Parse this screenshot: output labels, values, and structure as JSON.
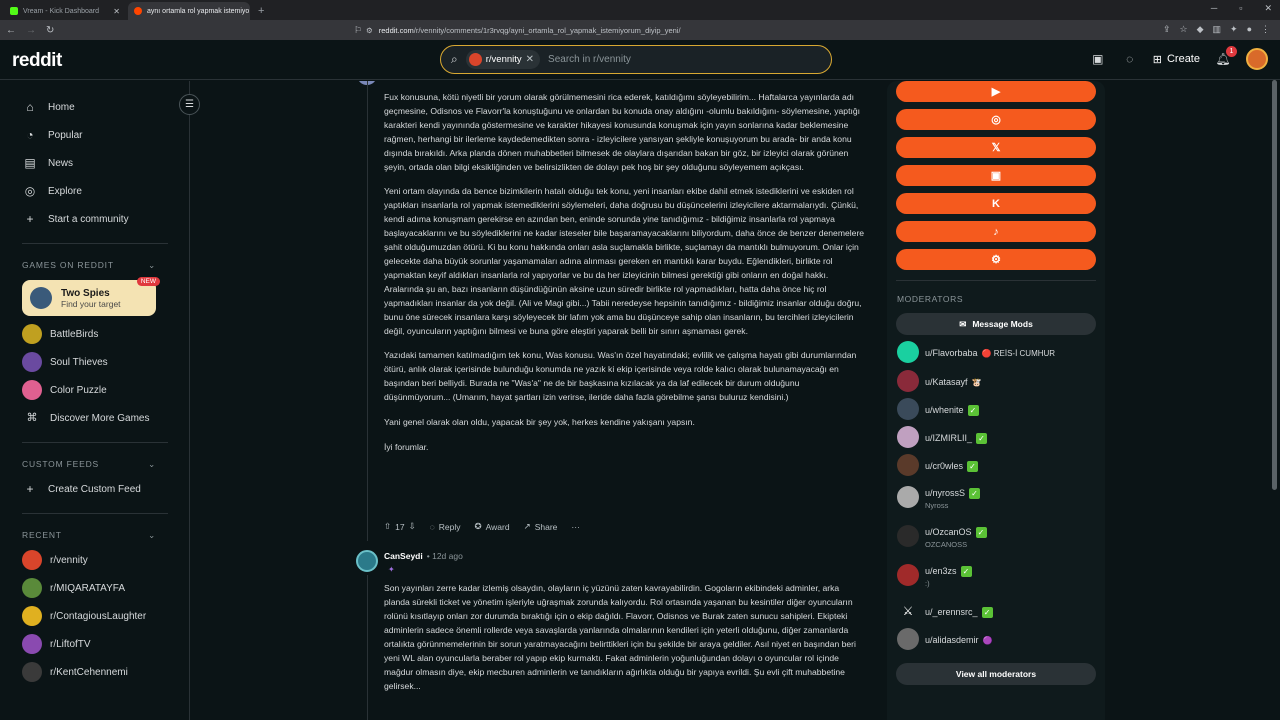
{
  "browser": {
    "tabs": [
      {
        "title": "Vream - Kick Dashboard",
        "color": "#53fc18",
        "active": false
      },
      {
        "title": "aynı ortamla rol yapmak istemiyo",
        "color": "#ff4500",
        "active": true
      }
    ],
    "url_host": "reddit.com",
    "url_path": "/r/vennity/comments/1r3rvqg/ayni_ortamla_rol_yapmak_istemiyorum_diyip_yeni/"
  },
  "header": {
    "logo": "reddit",
    "search_chip": "r/vennity",
    "search_placeholder": "Search in r/vennity",
    "create_label": "Create",
    "notif_count": "1"
  },
  "sidebar": {
    "nav": [
      {
        "label": "Home",
        "icon": "home-icon",
        "glyph": "⌂"
      },
      {
        "label": "Popular",
        "icon": "popular-icon",
        "glyph": "◔"
      },
      {
        "label": "News",
        "icon": "news-icon",
        "glyph": "▤"
      },
      {
        "label": "Explore",
        "icon": "explore-icon",
        "glyph": "◎"
      },
      {
        "label": "Start a community",
        "icon": "plus-icon",
        "glyph": "+"
      }
    ],
    "games_header": "GAMES ON REDDIT",
    "featured_game": {
      "title": "Two Spies",
      "subtitle": "Find your target",
      "badge": "NEW"
    },
    "games": [
      {
        "label": "BattleBirds",
        "color": "#c0a020"
      },
      {
        "label": "Soul Thieves",
        "color": "#6a4aa0"
      },
      {
        "label": "Color Puzzle",
        "color": "#e06090"
      },
      {
        "label": "Discover More Games",
        "color": ""
      }
    ],
    "custom_header": "CUSTOM FEEDS",
    "custom_item": "Create Custom Feed",
    "recent_header": "RECENT",
    "recent": [
      {
        "label": "r/vennity",
        "color": "#d9452b"
      },
      {
        "label": "r/MIQARATAYFA",
        "color": "#5a8a3a"
      },
      {
        "label": "r/ContagiousLaughter",
        "color": "#e0b020"
      },
      {
        "label": "r/LiftofTV",
        "color": "#8a4ab0"
      },
      {
        "label": "r/KentCehennemi",
        "color": "#3a3a3a"
      }
    ]
  },
  "comment1": {
    "paragraphs": [
      "Fux konusuna, kötü niyetli bir yorum olarak görülmemesini rica ederek, katıldığımı söyleyebilirim... Haftalarca yayınlarda adı geçmesine, Odisnos ve Flavorr'la konuştuğunu ve onlardan bu konuda onay aldığını -olumlu bakıldığını- söylemesine, yaptığı karakteri kendi yayınında göstermesine ve karakter hikayesi konusunda konuşmak için yayın sonlarına kadar beklemesine rağmen, herhangi bir ilerleme kaydedemedikten sonra - izleyicilere yansıyan şekliyle konuşuyorum bu arada- bir anda konu dışında bırakıldı. Arka planda dönen muhabbetleri bilmesek de olaylara dışarıdan bakan bir göz, bir izleyici olarak görünen şeyin, ortada olan bilgi eksikliğinden ve belirsizlikten de dolayı pek hoş bir şey olduğunu söyleyemem açıkçası.",
      "Yeni ortam olayında da bence bizimkilerin hatalı olduğu tek konu, yeni insanları ekibe dahil etmek istediklerini ve eskiden rol yaptıkları insanlarla rol yapmak istemediklerini söylemeleri, daha doğrusu bu düşüncelerini izleyicilere aktarmalarıydı. Çünkü, kendi adıma konuşmam gerekirse en azından ben, eninde sonunda yine tanıdığımız - bildiğimiz insanlarla rol yapmaya başlayacaklarını ve bu söylediklerini ne kadar isteseler bile başaramayacaklarını biliyordum, daha önce de benzer denemelere şahit olduğumuzdan ötürü. Ki bu konu hakkında onları asla suçlamakla birlikte, suçlamayı da mantıklı bulmuyorum. Onlar için gelecekte daha büyük sorunlar yaşamamaları adına alınması gereken en mantıklı karar buydu. Eğlendikleri, birlikte rol yapmaktan keyif aldıkları insanlarla rol yapıyorlar ve bu da her izleyicinin bilmesi gerektiği gibi onların en doğal hakkı. Aralarında şu an, bazı insanların düşündüğünün aksine uzun süredir birlikte rol yapmadıkları, hatta daha önce hiç rol yapmadıkları insanlar da yok değil. (Ali ve Magi gibi...) Tabii neredeyse hepsinin tanıdığımız - bildiğimiz insanlar olduğu doğru, bunu öne sürecek insanlara karşı söyleyecek bir lafım yok ama bu düşünceye sahip olan insanların, bu tercihleri izleyicilerin değil, oyuncuların yaptığını bilmesi ve buna göre eleştiri yaparak belli bir sınırı aşmaması gerek.",
      "Yazıdaki tamamen katılmadığım tek konu, Was konusu. Was'ın özel hayatındaki; evlilik ve çalışma hayatı gibi durumlarından ötürü, anlık olarak içerisinde bulunduğu konumda ne yazık ki ekip içerisinde veya rolde kalıcı olarak bulunamayacağı en başından beri belliydi. Burada ne \"Was'a\" ne de bir başkasına kızılacak ya da laf edilecek bir durum olduğunu düşünmüyorum... (Umarım, hayat şartları izin verirse, ileride daha fazla görebilme şansı buluruz kendisini.)",
      "Yani genel olarak olan oldu, yapacak bir şey yok, herkes kendine yakışanı yapsın.",
      "İyi forumlar."
    ],
    "votes": "17",
    "reply": "Reply",
    "award": "Award",
    "share": "Share",
    "more": "···"
  },
  "comment2": {
    "username": "CanSeydi",
    "meta": "• 12d ago",
    "body": "Son yayınları zerre kadar izlemiş olsaydın, olayların iç yüzünü zaten kavrayabilirdin. Gogoların ekibindeki adminler, arka planda sürekli ticket ve yönetim işleriyle uğraşmak zorunda kalıyordu. Rol ortasında yaşanan bu kesintiler diğer oyuncuların rolünü kısıtlayıp onları zor durumda bıraktığı için o ekip dağıldı. Flavorr, Odisnos ve Burak zaten sunucu sahipleri. Ekipteki adminlerin sadece önemli rollerde veya savaşlarda yanlarında olmalarının kendileri için yeterli olduğunu, diğer zamanlarda ortalıkta görünmemelerinin bir sorun yaratmayacağını belirttikleri için bu şekilde bir araya geldiler. Asıl niyet en başından beri yeni WL alan oyuncularla beraber rol yapıp ekip kurmaktı. Fakat adminlerin yoğunluğundan dolayı o oyuncular rol içinde mağdur olmasın diye, ekip mecburen adminlerin ve tanıdıkların ağırlıkta olduğu bir yapıya evrildi. Şu evli çift muhabbetine gelirsek..."
  },
  "rsidebar": {
    "socials": [
      "youtube-icon",
      "instagram-icon",
      "x-icon",
      "twitch-icon",
      "kick-icon",
      "tiktok-icon",
      "steam-icon"
    ],
    "social_glyphs": [
      "▶",
      "◎",
      "𝕏",
      "▣",
      "K",
      "♪",
      "⚙"
    ],
    "moderators_title": "MODERATORS",
    "message_mods": "Message Mods",
    "mods": [
      {
        "name": "u/Flavorbaba",
        "flair": "🔴 REİS-İ CUMHUR",
        "sub": "",
        "color": "#1ad0a0",
        "check": false
      },
      {
        "name": "u/Katasayf",
        "flair": "🐮",
        "sub": "",
        "color": "#8a2a3a",
        "check": false
      },
      {
        "name": "u/whenite",
        "flair": "",
        "sub": "",
        "color": "#3a4a5a",
        "check": true
      },
      {
        "name": "u/IZMIRLII_",
        "flair": "",
        "sub": "",
        "color": "#c0a0c0",
        "check": true
      },
      {
        "name": "u/cr0wles",
        "flair": "",
        "sub": "",
        "color": "#5a3a2a",
        "check": true
      },
      {
        "name": "u/nyrossS",
        "flair": "",
        "sub": "Nyross",
        "color": "#aaaaaa",
        "check": true
      },
      {
        "name": "u/OzcanOS",
        "flair": "",
        "sub": "OZCANOSS",
        "color": "#2a2a2a",
        "check": true
      },
      {
        "name": "u/en3zs",
        "flair": "",
        "sub": ":)",
        "color": "#a02a2a",
        "check": true
      },
      {
        "name": "u/_erennsrc_",
        "flair": "",
        "sub": "",
        "color": "#0f1a1c",
        "check": true
      },
      {
        "name": "u/alidasdemir",
        "flair": "🟣",
        "sub": "",
        "color": "#6a6a6a",
        "check": false
      }
    ],
    "view_all": "View all moderators"
  }
}
